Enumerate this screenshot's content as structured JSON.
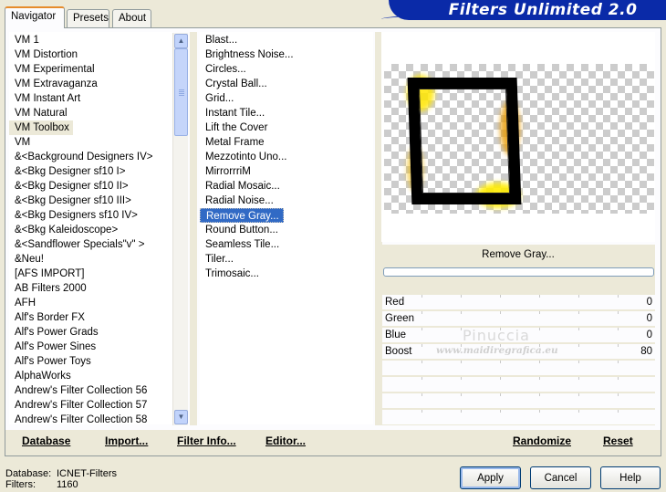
{
  "header": {
    "title": "Filters Unlimited 2.0",
    "tabs": [
      "Navigator",
      "Presets",
      "About"
    ]
  },
  "categories": {
    "items": [
      "VM 1",
      "VM Distortion",
      "VM Experimental",
      "VM Extravaganza",
      "VM Instant Art",
      "VM Natural",
      "VM Toolbox",
      "VM",
      "&<Background Designers IV>",
      "&<Bkg Designer sf10 I>",
      "&<Bkg Designer sf10 II>",
      "&<Bkg Designer sf10 III>",
      "&<Bkg Designers sf10 IV>",
      "&<Bkg Kaleidoscope>",
      "&<Sandflower Specials\"v\" >",
      "&Neu!",
      "[AFS IMPORT]",
      "AB Filters 2000",
      "AFH",
      "Alf's Border FX",
      "Alf's Power Grads",
      "Alf's Power Sines",
      "Alf's Power Toys",
      "AlphaWorks",
      "Andrew's Filter Collection 56",
      "Andrew's Filter Collection 57",
      "Andrew's Filter Collection 58"
    ],
    "selected": "VM Toolbox"
  },
  "filters": {
    "items": [
      "Blast...",
      "Brightness Noise...",
      "Circles...",
      "Crystal Ball...",
      "Grid...",
      "Instant Tile...",
      "Lift the Cover",
      "Metal Frame",
      "Mezzotinto Uno...",
      "MirrorrriM",
      "Radial Mosaic...",
      "Radial Noise...",
      "Remove Gray...",
      "Round Button...",
      "Seamless Tile...",
      "Tiler...",
      "Trimosaic..."
    ],
    "selected": "Remove Gray..."
  },
  "preview": {
    "filter_name": "Remove Gray...",
    "progress": 0
  },
  "parameters": [
    {
      "label": "Red",
      "value": "0"
    },
    {
      "label": "Green",
      "value": "0"
    },
    {
      "label": "Blue",
      "value": "0"
    },
    {
      "label": "Boost",
      "value": "80"
    }
  ],
  "watermark": {
    "name": "Pinuccia",
    "url": "www.maidiregrafica.eu"
  },
  "toolbar": {
    "database": "Database",
    "import": "Import...",
    "filter_info": "Filter Info...",
    "editor": "Editor...",
    "randomize": "Randomize",
    "reset": "Reset"
  },
  "status": {
    "database_label": "Database:",
    "database_value": "ICNET-Filters",
    "filters_label": "Filters:",
    "filters_value": "1160"
  },
  "buttons": {
    "apply": "Apply",
    "cancel": "Cancel",
    "help": "Help"
  },
  "colors": {
    "banner": "#0a2aa8",
    "selection": "#316ac5",
    "dialog_bg": "#ece9d8"
  }
}
